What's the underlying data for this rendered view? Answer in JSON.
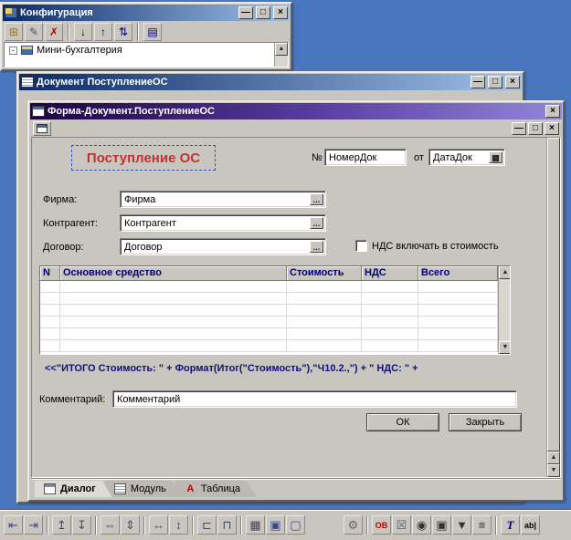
{
  "window_controls": {
    "minimize": "—",
    "maximize": "□",
    "restore": "□",
    "close": "×"
  },
  "icons": {
    "scroll_up": "▲",
    "scroll_down": "▼",
    "ellipsis": "...",
    "calendar": "▦",
    "tree_expander": "-",
    "table_tab_glyph": "А"
  },
  "config_window": {
    "title": "Конфигурация",
    "toolbar": [
      {
        "name": "new",
        "glyph": "⊞"
      },
      {
        "name": "properties",
        "glyph": "✎"
      },
      {
        "name": "delete",
        "glyph": "✗"
      },
      {
        "name": "move-down",
        "glyph": "↓"
      },
      {
        "name": "move-up",
        "glyph": "↑"
      },
      {
        "name": "sort",
        "glyph": "⇅"
      },
      {
        "name": "report",
        "glyph": "▤"
      }
    ],
    "tree_root": "Мини-бухгалтерия"
  },
  "doc_window": {
    "title": "Документ ПоступлениеОС"
  },
  "form_window": {
    "title": "Форма-Документ.ПоступлениеОС",
    "form": {
      "header_label": "Поступление ОС",
      "number_label": "№",
      "number_value": "НомерДок",
      "date_prefix_label": "от",
      "date_value": "ДатаДок",
      "firm_label": "Фирма:",
      "firm_value": "Фирма",
      "contractor_label": "Контрагент:",
      "contractor_value": "Контрагент",
      "contract_label": "Договор:",
      "contract_value": "Договор",
      "vat_checkbox_label": "НДС включать в стоимость",
      "table_headers": [
        "N",
        "Основное средство",
        "Стоимость",
        "НДС",
        "Всего"
      ],
      "total_formula": "<<\"ИТОГО Стоимость: \" + Формат(Итог(\"Стоимость\"),\"Ч10.2.,\") + \" НДС: \" +",
      "comment_label": "Комментарий:",
      "comment_value": "Комментарий",
      "ok_button": "ОК",
      "close_button": "Закрыть"
    },
    "tabs": [
      {
        "label": "Диалог"
      },
      {
        "label": "Модуль"
      },
      {
        "label": "Таблица"
      }
    ]
  },
  "bottom_toolbar": [
    {
      "name": "align-left",
      "glyph": "⇤"
    },
    {
      "name": "align-right",
      "glyph": "⇥"
    },
    {
      "name": "align-top",
      "glyph": "↥"
    },
    {
      "name": "align-bottom",
      "glyph": "↧"
    },
    {
      "name": "center-horizontal",
      "glyph": "⇔"
    },
    {
      "name": "center-vertical",
      "glyph": "⇕"
    },
    {
      "name": "space-horizontal",
      "glyph": "↔"
    },
    {
      "name": "space-vertical",
      "glyph": "↕"
    },
    {
      "name": "same-width",
      "glyph": "⊏"
    },
    {
      "name": "same-height",
      "glyph": "⊓"
    },
    {
      "name": "grid",
      "glyph": "▦"
    },
    {
      "name": "bring-front",
      "glyph": "▣"
    },
    {
      "name": "send-back",
      "glyph": "▢"
    },
    {
      "name": "tools",
      "glyph": "⚙"
    },
    {
      "name": "ole-object",
      "glyph": "ОВ"
    },
    {
      "name": "frame",
      "glyph": "☒"
    },
    {
      "name": "radio-button",
      "glyph": "◉"
    },
    {
      "name": "checkbox",
      "glyph": "▣"
    },
    {
      "name": "combobox",
      "glyph": "▼"
    },
    {
      "name": "listbox",
      "glyph": "≡"
    },
    {
      "name": "text-label",
      "glyph": "Т"
    },
    {
      "name": "text-field",
      "glyph": "ab|"
    }
  ]
}
